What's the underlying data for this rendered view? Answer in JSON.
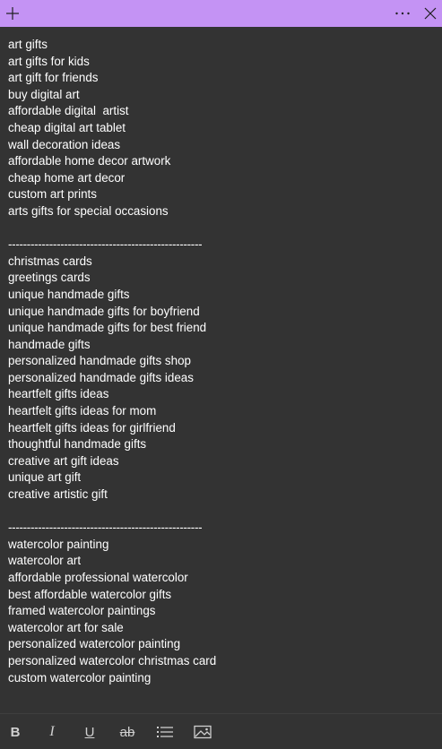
{
  "titlebar": {
    "add_icon": "plus-icon",
    "more_icon": "ellipsis-icon",
    "close_icon": "close-icon",
    "accent_color": "#c493f4"
  },
  "note": {
    "lines": [
      "art gifts",
      "art gifts for kids",
      "art gift for friends",
      "buy digital art",
      "affordable digital  artist",
      "cheap digital art tablet",
      "wall decoration ideas",
      "affordable home decor artwork",
      "cheap home art decor",
      "custom art prints",
      "arts gifts for special occasions",
      "",
      "----------------------------------------------------",
      "christmas cards",
      "greetings cards",
      "unique handmade gifts",
      "unique handmade gifts for boyfriend",
      "unique handmade gifts for best friend",
      "handmade gifts",
      "personalized handmade gifts shop",
      "personalized handmade gifts ideas",
      "heartfelt gifts ideas",
      "heartfelt gifts ideas for mom",
      "heartfelt gifts ideas for girlfriend",
      "thoughtful handmade gifts",
      "creative art gift ideas",
      "unique art gift",
      "creative artistic gift",
      "",
      "----------------------------------------------------",
      "watercolor painting",
      "watercolor art",
      "affordable professional watercolor",
      "best affordable watercolor gifts",
      "framed watercolor paintings",
      "watercolor art for sale",
      "personalized watercolor painting",
      "personalized watercolor christmas card",
      "custom watercolor painting"
    ]
  },
  "toolbar": {
    "bold_label": "B",
    "italic_label": "I",
    "underline_label": "U",
    "strikethrough_label": "ab",
    "list_icon": "bullet-list-icon",
    "image_icon": "image-icon"
  }
}
